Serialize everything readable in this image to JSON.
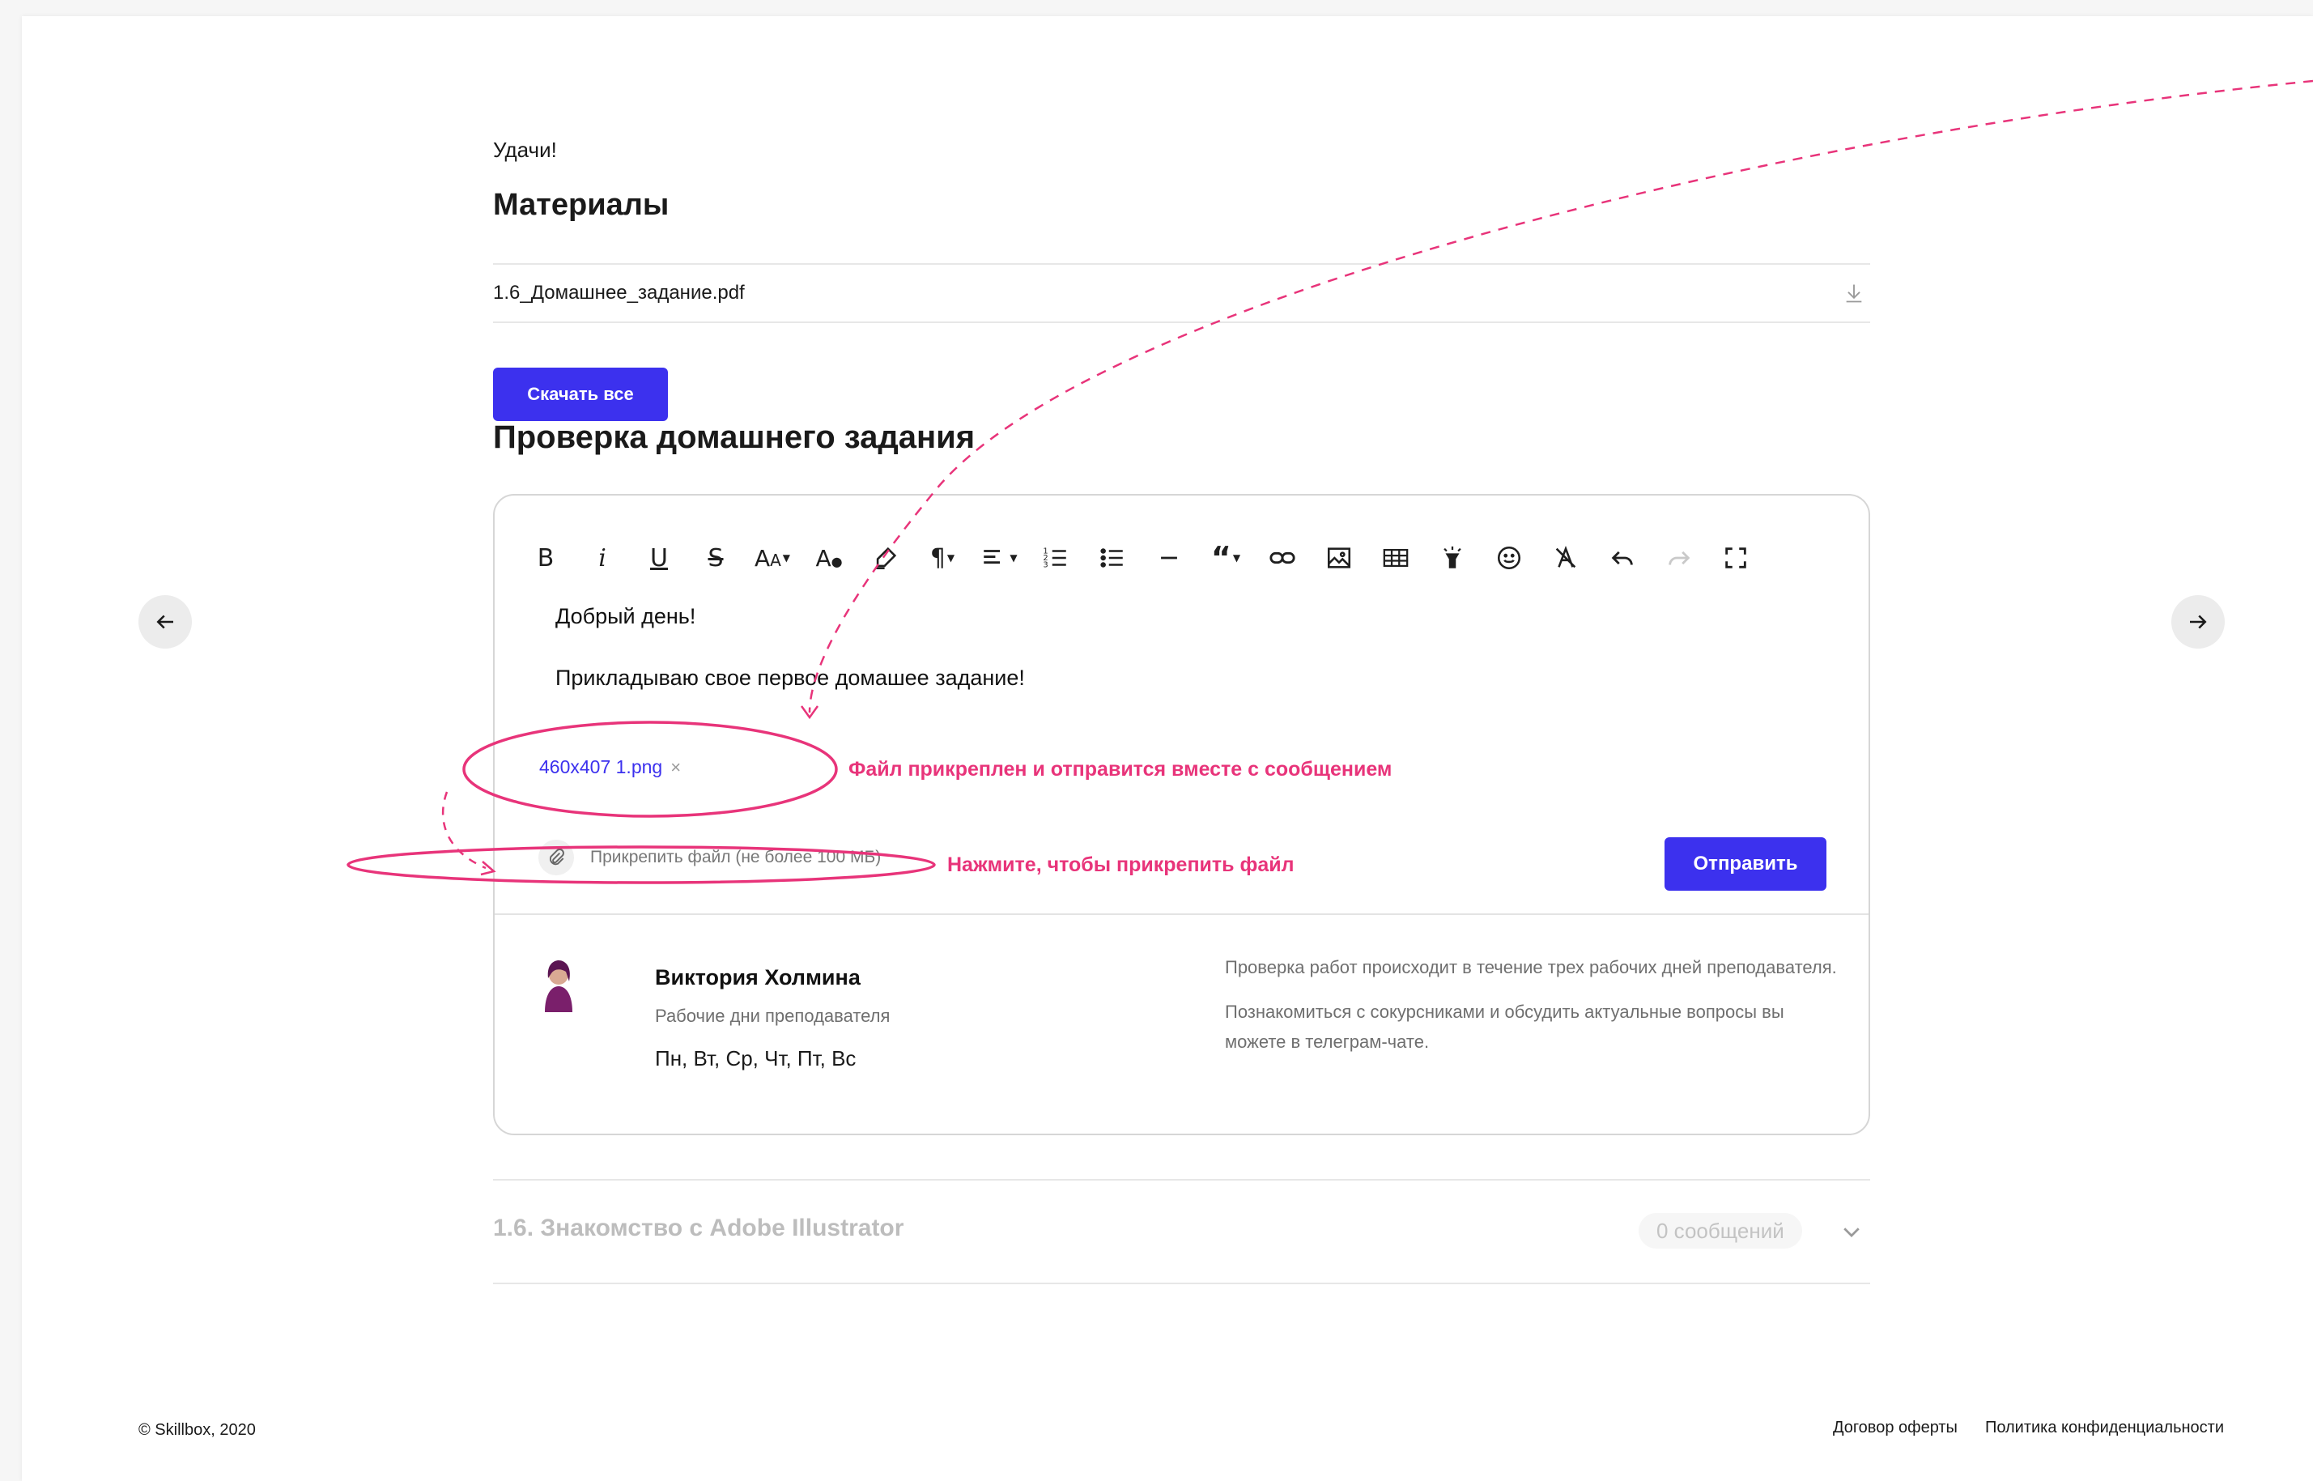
{
  "page": {
    "good_luck": "Удачи!",
    "materials_heading": "Материалы",
    "file_name": "1.6_Домашнее_задание.pdf",
    "download_all_label": "Скачать все",
    "homework_heading": "Проверка домашнего задания"
  },
  "editor": {
    "toolbar": [
      {
        "name": "bold-button",
        "glyph": "B"
      },
      {
        "name": "italic-button",
        "glyph": "i"
      },
      {
        "name": "underline-button",
        "glyph": "U"
      },
      {
        "name": "strikethrough-button",
        "glyph": "S"
      },
      {
        "name": "font-size-button",
        "glyph": "AA"
      },
      {
        "name": "text-color-button",
        "glyph": "A"
      },
      {
        "name": "highlight-button",
        "glyph": "highlighter-icon"
      },
      {
        "name": "paragraph-button",
        "glyph": "¶"
      },
      {
        "name": "align-button",
        "glyph": "align-icon"
      },
      {
        "name": "ordered-list-button",
        "glyph": "ordered-list-icon"
      },
      {
        "name": "bullet-list-button",
        "glyph": "bullet-list-icon"
      },
      {
        "name": "horizontal-line-button",
        "glyph": "line-icon"
      },
      {
        "name": "quote-button",
        "glyph": "quote-icon"
      },
      {
        "name": "link-button",
        "glyph": "link-icon"
      },
      {
        "name": "image-button",
        "glyph": "image-icon"
      },
      {
        "name": "table-button",
        "glyph": "table-icon"
      },
      {
        "name": "flashlight-button",
        "glyph": "flashlight-icon"
      },
      {
        "name": "emoji-button",
        "glyph": "smile-icon"
      },
      {
        "name": "clear-format-button",
        "glyph": "clear-format-icon"
      },
      {
        "name": "undo-button",
        "glyph": "undo-icon"
      },
      {
        "name": "redo-button",
        "glyph": "redo-icon"
      },
      {
        "name": "fullscreen-button",
        "glyph": "fullscreen-icon"
      }
    ],
    "message_line1": "Добрый день!",
    "message_line2": "Прикладываю свое первое домашее задание!",
    "attached_file": "460x407 1.png",
    "attached_remove": "×",
    "attach_label": "Прикрепить файл (не более 100 МБ)",
    "send_label": "Отправить"
  },
  "teacher": {
    "name": "Виктория Холмина",
    "workdays_label": "Рабочие дни преподавателя",
    "workdays": "Пн, Вт, Ср, Чт, Пт, Вс",
    "info1": "Проверка работ происходит в течение трех рабочих дней преподавателя.",
    "info2": "Познакомиться с сокурсниками и обсудить актуальные вопросы вы можете в телеграм-чате."
  },
  "lesson": {
    "title": "1.6.  Знакомство с Adobe Illustrator",
    "count": "0   сообщений"
  },
  "annotations": {
    "file_attached_note": "Файл прикреплен и отправится вместе с сообщением",
    "click_to_attach_note": "Нажмите, чтобы прикрепить файл",
    "color": "#e8347a"
  },
  "footer": {
    "copyright": "© Skillbox, 2020",
    "offer_link": "Договор оферты",
    "privacy_link": "Политика конфиденциальности"
  },
  "colors": {
    "accent": "#3c31ee",
    "annotation": "#e8347a"
  }
}
